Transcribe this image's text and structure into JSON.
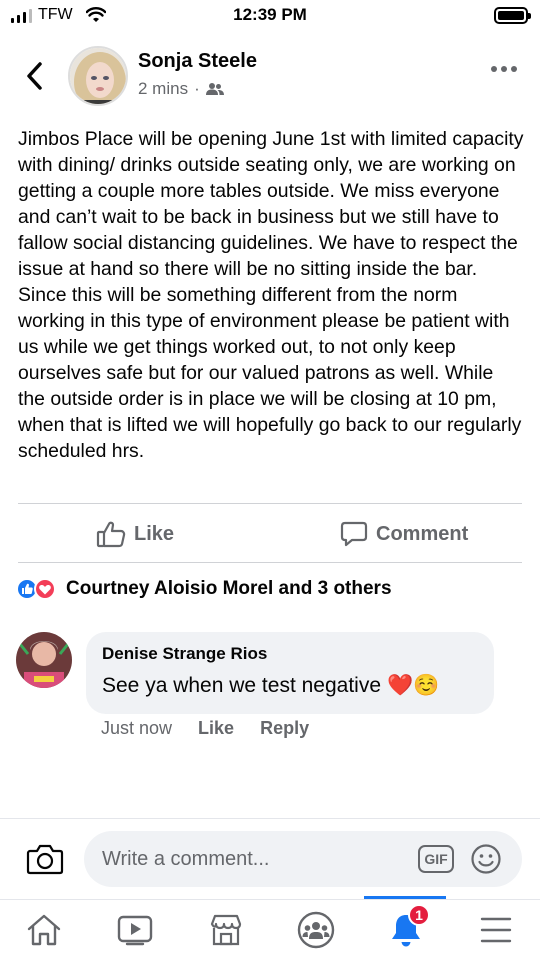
{
  "status_bar": {
    "carrier": "TFW",
    "time": "12:39 PM",
    "icons": [
      "signal-icon",
      "wifi-icon",
      "battery-icon"
    ]
  },
  "post": {
    "author": "Sonja Steele",
    "time": "2 mins",
    "separator": "·",
    "audience_icon": "friends-icon",
    "text": "Jimbos Place will be opening June 1st with limited capacity with dining/ drinks outside seating only, we are working on getting a couple more tables outside. We miss everyone and can’t wait to be back in business but we still have to  fallow social distancing guidelines. We have to respect the issue at hand so there will be no sitting inside the bar. Since this will be something different from the norm working in this type of environment please be patient with us while we get things worked out, to not only keep ourselves safe but for our valued patrons as well. While the outside order is in place we will be closing at 10 pm, when that is lifted we will hopefully go back to our regularly scheduled hrs."
  },
  "actions": {
    "like_label": "Like",
    "comment_label": "Comment"
  },
  "reactions": {
    "summary": "Courtney Aloisio Morel and 3 others",
    "types": [
      "like-reaction-icon",
      "love-reaction-icon"
    ]
  },
  "comment": {
    "author": "Denise Strange Rios",
    "text": "See ya when we test negative",
    "emojis": "❤️☺️",
    "time": "Just now",
    "like_label": "Like",
    "reply_label": "Reply"
  },
  "composer": {
    "placeholder": "Write a comment...",
    "gif_label": "GIF"
  },
  "bottom_nav": {
    "items": [
      "home-icon",
      "watch-icon",
      "marketplace-icon",
      "groups-icon",
      "notifications-icon",
      "menu-icon"
    ],
    "notification_count": "1"
  },
  "colors": {
    "accent": "#1877f2",
    "secondary_text": "#65676b",
    "bubble": "#f0f2f5",
    "badge": "#e41e3f"
  }
}
